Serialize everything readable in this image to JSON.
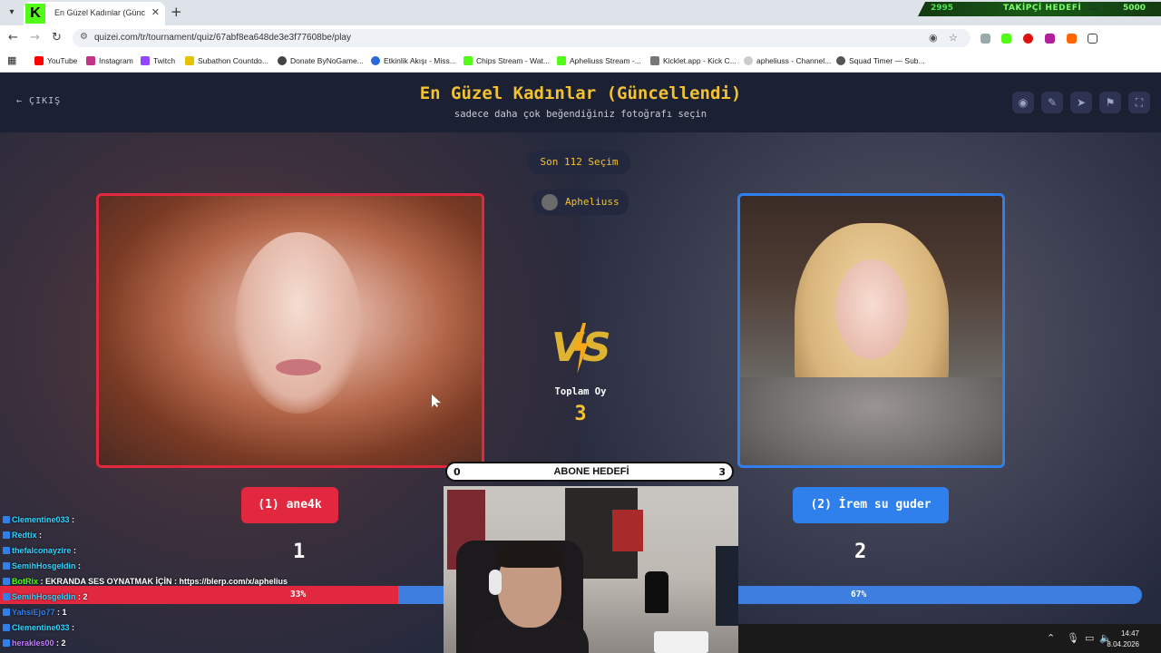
{
  "browser": {
    "tab_title": "En Güzel Kadınlar (Güncellendi)",
    "url": "quizei.com/tr/tournament/quiz/67abf8ea648de3e3f77608be/play",
    "bookmarks": [
      "YouTube",
      "Instagram",
      "Twitch",
      "Subathon Countdo...",
      "Donate ByNoGame...",
      "Etkinlik Akışı - Miss...",
      "Chips Stream - Wat...",
      "Apheliuss Stream -...",
      "Kicklet.app - Kick C...",
      "apheliuss - Channel...",
      "Squad Timer — Sub..."
    ]
  },
  "stream_overlay": {
    "left_value": "2995",
    "goal_label": "TAKİPÇİ HEDEFİ",
    "right_value": "5000"
  },
  "header": {
    "back_label": "ÇIKIŞ",
    "title": "En Güzel Kadınlar (Güncellendi)",
    "subtitle": "sadece daha çok beğendiğiniz fotoğrafı seçin"
  },
  "match": {
    "recent_label": "Son 112 Seçim",
    "player_name": "Apheliuss",
    "total_label": "Toplam Oy",
    "total_votes": "3",
    "left": {
      "label": "(1) ane4k",
      "score": "1",
      "percent": "33%",
      "share": 0.33
    },
    "right": {
      "label": "(2) İrem su guder",
      "score": "2",
      "percent": "67%"
    }
  },
  "sub_goal": {
    "label": "ABONE HEDEFİ",
    "current": "0",
    "target": "3"
  },
  "chat": [
    {
      "user": "Clementine033",
      "text": " :",
      "color": "#2fd4ff"
    },
    {
      "user": "Redtix",
      "text": " :",
      "color": "#2fd4ff"
    },
    {
      "user": "thefalconayzire",
      "text": " :",
      "color": "#2fd4ff"
    },
    {
      "user": "SemihHosgeldin",
      "text": " :",
      "color": "#2fd4ff"
    },
    {
      "user": "BotRix",
      "text": " : EKRANDA SES OYNATMAK İÇİN : https://blerp.com/x/aphelius",
      "color": "#53fc18"
    },
    {
      "user": "SemihHosgeldin",
      "text": " : 2",
      "color": "#2fd4ff"
    },
    {
      "user": "YahsiEjo77",
      "text": " : 1",
      "color": "#2f80ed"
    },
    {
      "user": "Clementine033",
      "text": " :",
      "color": "#2fd4ff"
    },
    {
      "user": "herakles00",
      "text": " : 2",
      "color": "#c47cff"
    }
  ],
  "taskbar": {
    "time": "14:47",
    "date": "8.04.2026"
  },
  "colors": {
    "accent": "#f2c230",
    "left": "#e2283e",
    "right": "#2f80ed"
  }
}
